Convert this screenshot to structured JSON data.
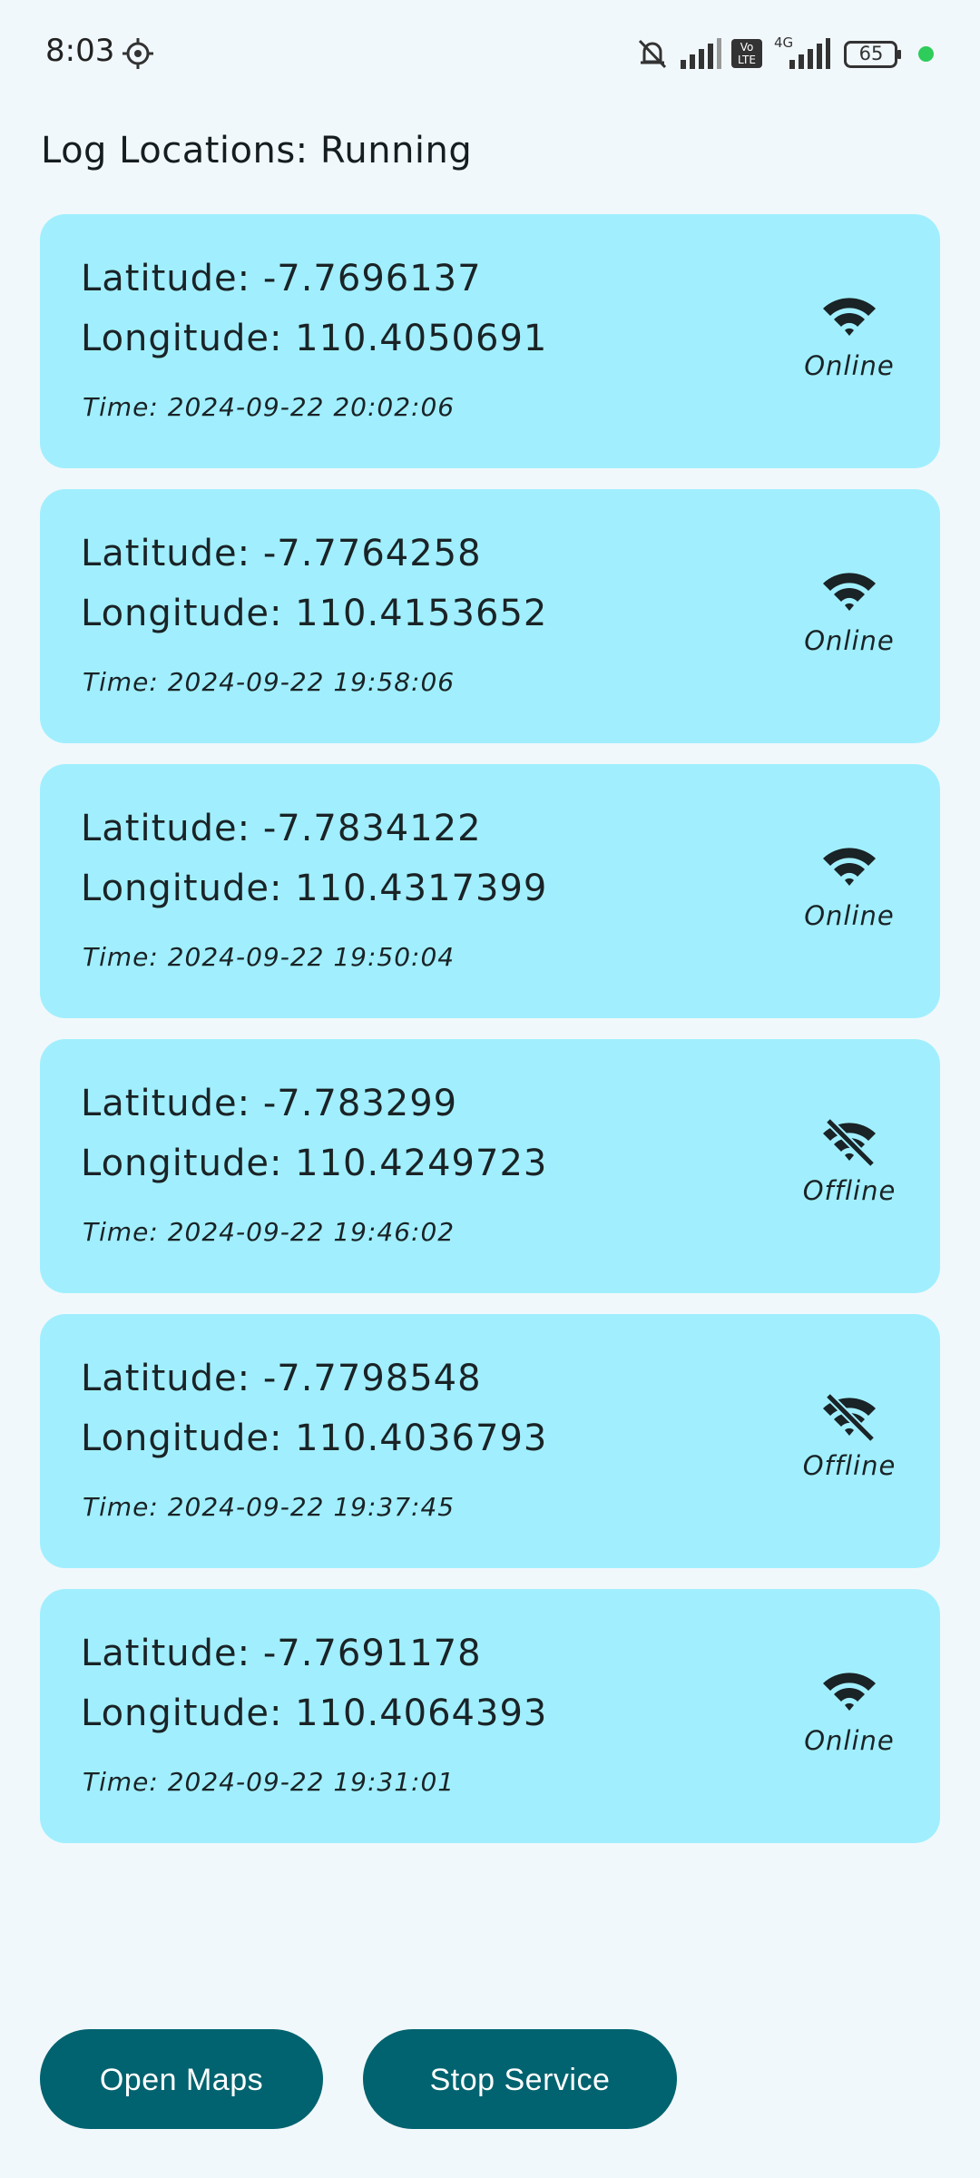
{
  "status_bar": {
    "time": "8:03",
    "icons": [
      "location-target-icon",
      "silent-bell-icon",
      "signal-icon",
      "volte-icon",
      "4g-signal-icon"
    ],
    "network_type": "4G",
    "volte_label": "Vo LTE",
    "battery": "65",
    "dot_color": "#2ecc5b"
  },
  "page_title": "Log Locations: Running",
  "logs": [
    {
      "latitude": "Latitude: -7.7696137",
      "longitude": "Longitude: 110.4050691",
      "time": "Time: 2024-09-22 20:02:06",
      "status": "Online",
      "icon": "wifi-icon"
    },
    {
      "latitude": "Latitude: -7.7764258",
      "longitude": "Longitude: 110.4153652",
      "time": "Time: 2024-09-22 19:58:06",
      "status": "Online",
      "icon": "wifi-icon"
    },
    {
      "latitude": "Latitude: -7.7834122",
      "longitude": "Longitude: 110.4317399",
      "time": "Time: 2024-09-22 19:50:04",
      "status": "Online",
      "icon": "wifi-icon"
    },
    {
      "latitude": "Latitude: -7.783299",
      "longitude": "Longitude: 110.4249723",
      "time": "Time: 2024-09-22 19:46:02",
      "status": "Offline",
      "icon": "wifi-off-icon"
    },
    {
      "latitude": "Latitude: -7.7798548",
      "longitude": "Longitude: 110.4036793",
      "time": "Time: 2024-09-22 19:37:45",
      "status": "Offline",
      "icon": "wifi-off-icon"
    },
    {
      "latitude": "Latitude: -7.7691178",
      "longitude": "Longitude: 110.4064393",
      "time": "Time: 2024-09-22 19:31:01",
      "status": "Online",
      "icon": "wifi-icon"
    }
  ],
  "buttons": {
    "open_maps": "Open Maps",
    "stop_service": "Stop Service"
  },
  "colors": {
    "card_bg": "#a1effe",
    "button_bg": "#00636f",
    "page_bg": "#f1f8fb"
  }
}
